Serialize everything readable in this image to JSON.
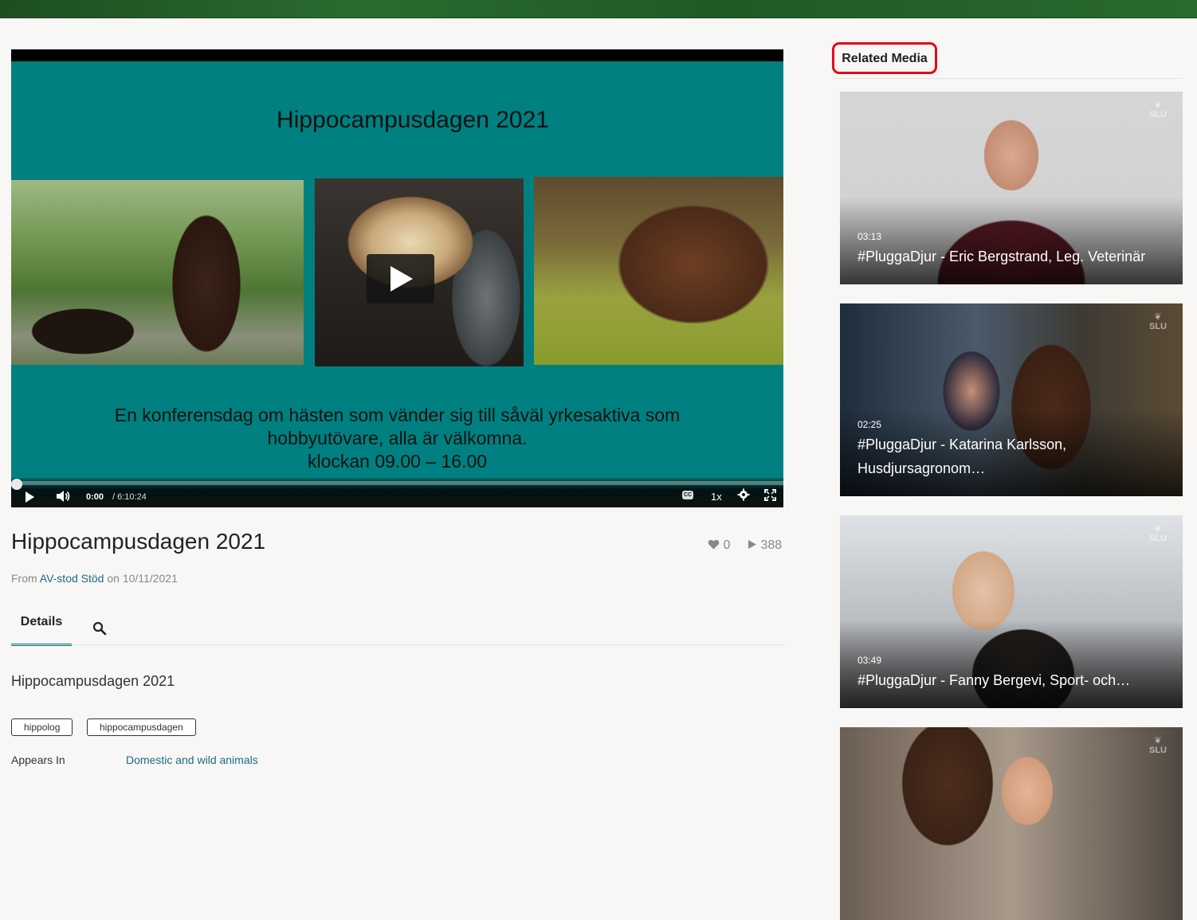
{
  "player": {
    "slide_title": "Hippocampusdagen 2021",
    "slide_desc_1": "En konferensdag om hästen som vänder sig till såväl yrkesaktiva som",
    "slide_desc_2": "hobbyutövare, alla är välkomna.",
    "slide_desc_3": "klockan 09.00 – 16.00",
    "time_current": "0:00",
    "time_duration": "/ 6:10:24",
    "cc_label": "CC",
    "speed": "1x",
    "progress": 0
  },
  "media": {
    "title": "Hippocampusdagen 2021",
    "likes": "0",
    "plays": "388",
    "from_prefix": "From ",
    "owner": "AV-stod Stöd",
    "date_prefix": " on ",
    "date": "10/11/2021"
  },
  "tabs": {
    "details": "Details"
  },
  "details": {
    "description": "Hippocampusdagen 2021",
    "tags": [
      "hippolog",
      "hippocampusdagen"
    ],
    "appears_in_label": "Appears In",
    "appears_in_link": "Domestic and wild animals"
  },
  "sidebar": {
    "heading": "Related Media",
    "logo_text": "SLU",
    "items": [
      {
        "duration": "03:13",
        "title": "#PluggaDjur - Eric Bergstrand, Leg. Veterinär"
      },
      {
        "duration": "02:25",
        "title": "#PluggaDjur - Katarina Karlsson, Husdjursagronom…"
      },
      {
        "duration": "03:49",
        "title": "#PluggaDjur - Fanny Bergevi, Sport- och…"
      },
      {
        "duration": "",
        "title": ""
      }
    ]
  },
  "colors": {
    "accent": "#008080",
    "link": "#1a6b87",
    "header": "#1f5a26",
    "highlight": "#e2061a"
  }
}
